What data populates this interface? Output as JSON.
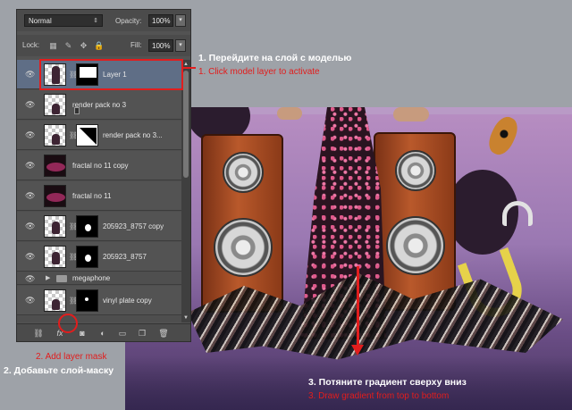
{
  "layers_panel": {
    "blend_mode": "Normal",
    "opacity_label": "Opacity:",
    "opacity_value": "100%",
    "lock_label": "Lock:",
    "fill_label": "Fill:",
    "fill_value": "100%",
    "layers": [
      {
        "name": "Layer 1",
        "selected": true
      },
      {
        "name": "render pack no 3"
      },
      {
        "name": "render pack no 3..."
      },
      {
        "name": "fractal no 11 copy"
      },
      {
        "name": "fractal no 11"
      },
      {
        "name": "205923_8757 copy"
      },
      {
        "name": "205923_8757"
      },
      {
        "name": "megaphone",
        "type": "group"
      },
      {
        "name": "vinyl plate copy"
      }
    ],
    "footer_icons": [
      "link-icon",
      "fx-icon",
      "add-layer-mask-icon",
      "adjustment-layer-icon",
      "group-folder-icon",
      "new-layer-icon",
      "trash-icon"
    ]
  },
  "annotations": {
    "step1_ru": "1. Перейдите на слой с моделью",
    "step1_en": "1. Click model layer to activate",
    "step2_en": "2. Add layer mask",
    "step2_ru": "2. Добавьте слой-маску",
    "step3_ru": "3. Потяните градиент сверху вниз",
    "step3_en": "3. Draw gradient from top to bottom"
  },
  "colors": {
    "annotation_red": "#e21d1d",
    "panel_bg": "#535353",
    "selected_row": "#5f6e86"
  }
}
